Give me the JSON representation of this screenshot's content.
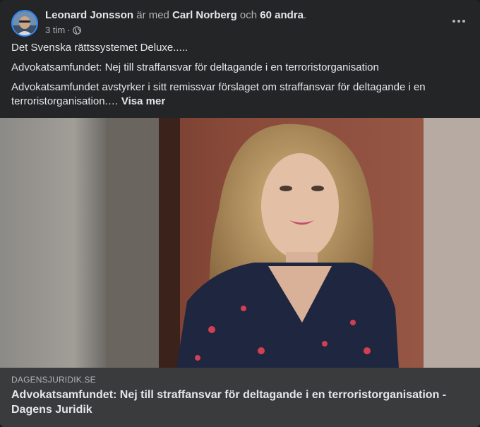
{
  "post": {
    "author": "Leonard Jonsson",
    "with_word": "är med",
    "tagged": "Carl Norberg",
    "and_word": "och",
    "others": "60 andra",
    "period": ".",
    "time": "3 tim",
    "separator": "·",
    "audience_icon": "globe-icon",
    "more_icon": "more-options-icon",
    "text_line1": "Det Svenska rättssystemet Deluxe.....",
    "text_line2": "Advokatsamfundet: Nej till straffansvar för deltagande i en terroristorganisation",
    "text_line3": "Advokatsamfundet avstyrker i sitt remissvar förslaget om straffansvar för deltagande i en terroristorganisation.…",
    "see_more": "Visa mer"
  },
  "link_preview": {
    "domain": "DAGENSJURIDIK.SE",
    "title": "Advokatsamfundet: Nej till straffansvar för deltagande i en terroristorganisation - Dagens Juridik"
  },
  "colors": {
    "background": "#242526",
    "link_box": "#3a3b3c",
    "text_primary": "#e4e6eb",
    "text_secondary": "#b0b3b8",
    "avatar_ring": "#2d88ff"
  }
}
